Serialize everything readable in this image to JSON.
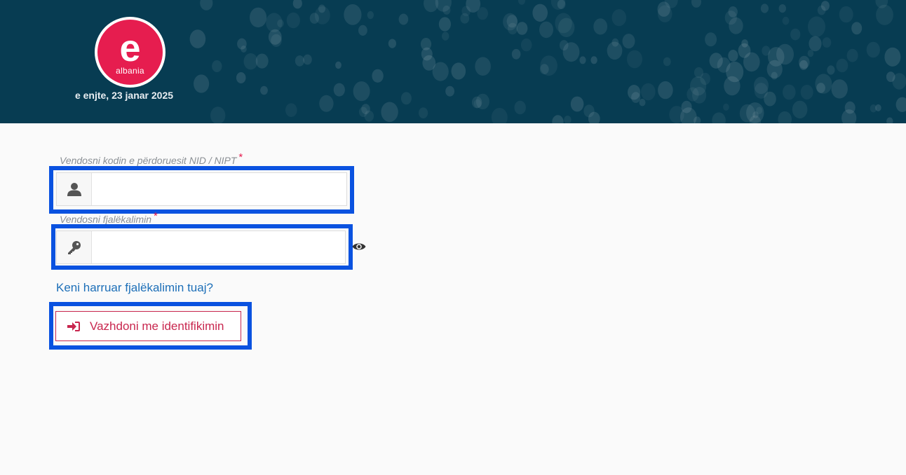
{
  "header": {
    "logo": {
      "letter": "e",
      "word": "albania"
    },
    "date": "e enjte, 23 janar 2025",
    "colors": {
      "background": "#073c52",
      "brand": "#e61d4f"
    }
  },
  "form": {
    "username": {
      "label": "Vendosni kodin e përdoruesit NID / NIPT",
      "required_mark": "*",
      "value": "",
      "icon": "user-icon"
    },
    "password": {
      "label": "Vendosni fjalëkalimin",
      "required_mark": "*",
      "value": "",
      "icon": "key-icon",
      "toggle_icon": "eye-icon"
    },
    "forgot_link": "Keni harruar fjalëkalimin tuaj?",
    "submit": {
      "label": "Vazhdoni me identifikimin",
      "icon": "sign-in-icon"
    }
  },
  "highlight_color": "#0a52e0"
}
